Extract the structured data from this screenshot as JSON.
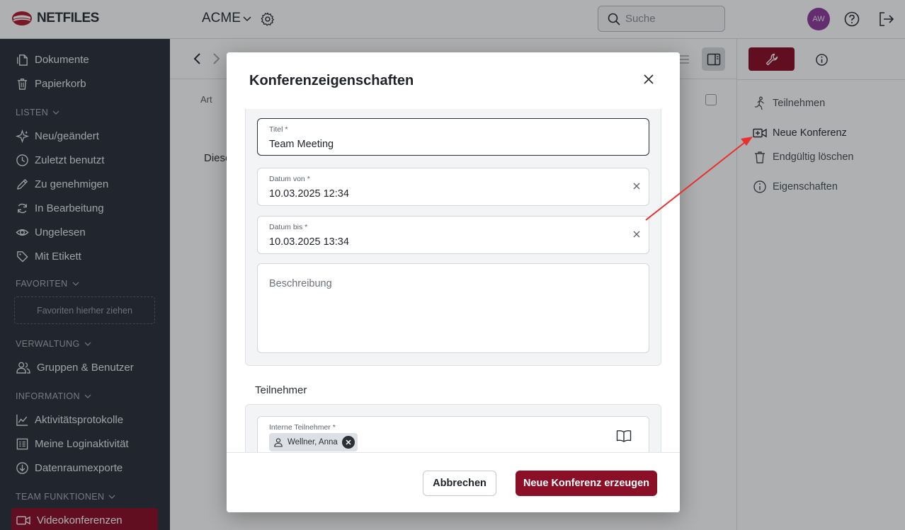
{
  "topbar": {
    "logo_text": "NETFILES",
    "workspace": "ACME",
    "search_placeholder": "Suche",
    "avatar_initials": "AW"
  },
  "sidebar": {
    "items_top": [
      {
        "label": "Dokumente",
        "icon": "documents-icon"
      },
      {
        "label": "Papierkorb",
        "icon": "trash-icon"
      }
    ],
    "lists_header": "LISTEN",
    "lists": [
      {
        "label": "Neu/geändert",
        "icon": "sparkle-icon"
      },
      {
        "label": "Zuletzt benutzt",
        "icon": "clock-icon"
      },
      {
        "label": "Zu genehmigen",
        "icon": "pencil-icon"
      },
      {
        "label": "In Bearbeitung",
        "icon": "refresh-icon"
      },
      {
        "label": "Ungelesen",
        "icon": "eye-icon"
      },
      {
        "label": "Mit Etikett",
        "icon": "tag-icon"
      }
    ],
    "favorites_header": "FAVORITEN",
    "favorites_drop": "Favoriten hierher ziehen",
    "admin_header": "VERWALTUNG",
    "admin_items": [
      {
        "label": "Gruppen & Benutzer",
        "icon": "users-icon"
      }
    ],
    "info_header": "INFORMATION",
    "info_items": [
      {
        "label": "Aktivitätsprotokolle",
        "icon": "activity-chart-icon"
      },
      {
        "label": "Meine Loginaktivität",
        "icon": "login-list-icon"
      },
      {
        "label": "Datenraumexporte",
        "icon": "download-circle-icon"
      }
    ],
    "team_header": "TEAM FUNKTIONEN",
    "team_active": {
      "label": "Videokonferenzen",
      "icon": "video-camera-icon"
    }
  },
  "main": {
    "column_art": "Art",
    "empty_text": "Diese"
  },
  "right_panel": {
    "actions": [
      {
        "label": "Teilnehmen",
        "icon": "walking-person-icon"
      },
      {
        "label": "Neue Konferenz",
        "icon": "video-add-icon"
      },
      {
        "label": "Endgültig löschen",
        "icon": "trash-icon"
      },
      {
        "label": "Eigenschaften",
        "icon": "info-icon"
      }
    ]
  },
  "modal": {
    "title": "Konferenzeigenschaften",
    "fields": {
      "title": {
        "label": "Titel *",
        "value": "Team Meeting"
      },
      "date_from": {
        "label": "Datum von *",
        "value": "10.03.2025 12:34"
      },
      "date_to": {
        "label": "Datum bis *",
        "value": "10.03.2025 13:34"
      },
      "description": {
        "placeholder": "Beschreibung"
      }
    },
    "participants_title": "Teilnehmer",
    "internal_participants": {
      "label": "Interne Teilnehmer *",
      "chips": [
        "Wellner, Anna"
      ]
    },
    "buttons": {
      "cancel": "Abbrechen",
      "create": "Neue Konferenz erzeugen"
    }
  },
  "colors": {
    "brand": "#8b1027",
    "sidebar_bg": "#2c323c",
    "annotation_arrow": "#e8302f"
  }
}
